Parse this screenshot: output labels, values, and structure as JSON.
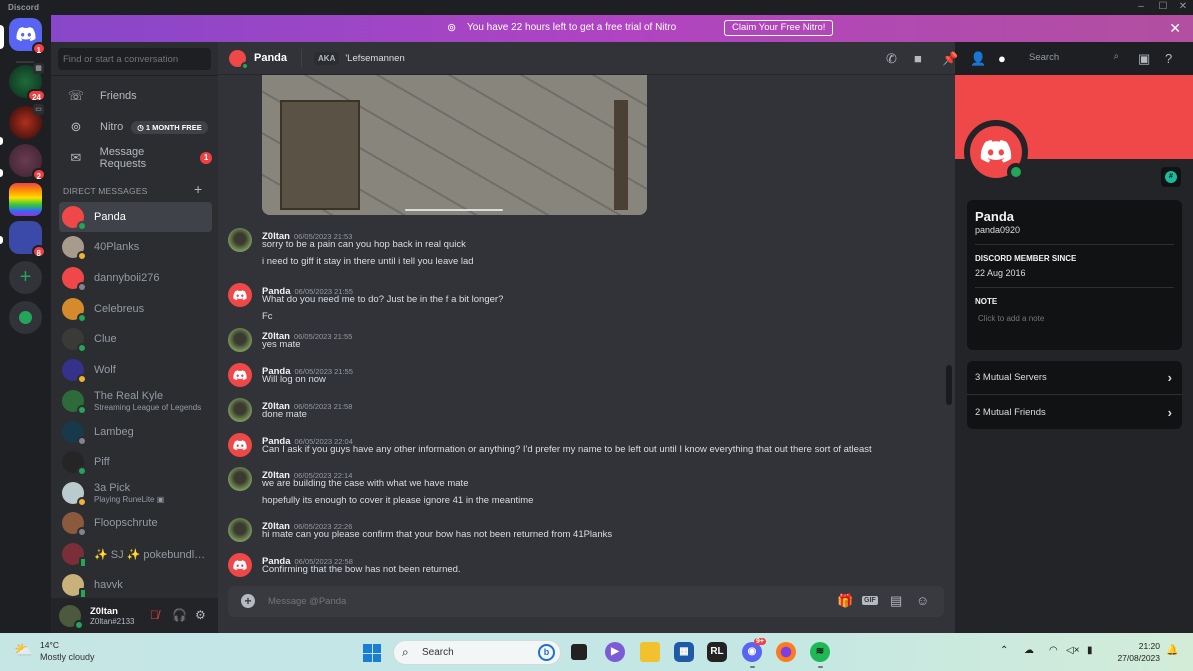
{
  "window": {
    "app_title": "Discord",
    "controls": [
      "minimize",
      "maximize",
      "close"
    ]
  },
  "server_rail": {
    "home": {
      "icon": "discord-logo-icon",
      "badge": "1"
    },
    "servers": [
      {
        "name": "server-pvm",
        "badge": "24",
        "status_icon": "calendar-icon"
      },
      {
        "name": "server-dark",
        "badge": "",
        "status_icon": "monitor-icon"
      },
      {
        "name": "server-p9k",
        "badge": "2",
        "status_icon": ""
      },
      {
        "name": "server-rs",
        "badge": "",
        "status_icon": ""
      },
      {
        "name": "server-folder",
        "badge": "8",
        "status_icon": ""
      }
    ],
    "add_server": "+",
    "explore": "compass-icon"
  },
  "nitro_banner": {
    "text": "You have 22 hours left to get a free trial of Nitro",
    "button": "Claim Your Free Nitro!",
    "close": "✕"
  },
  "dm_sidebar": {
    "search_placeholder": "Find or start a conversation",
    "nav": [
      {
        "label": "Friends",
        "icon": "friends-icon"
      },
      {
        "label": "Nitro",
        "icon": "nitro-icon",
        "tag": "1 MONTH FREE"
      },
      {
        "label": "Message Requests",
        "icon": "envelope-icon",
        "badge": "1"
      }
    ],
    "section_header": "DIRECT MESSAGES",
    "add": "+",
    "dms": [
      {
        "name": "Panda",
        "status": "online",
        "active": true,
        "color": "#f04848"
      },
      {
        "name": "40Planks",
        "status": "idle",
        "color": "#a79b8c"
      },
      {
        "name": "dannyboii276",
        "status": "offline",
        "color": "#f04848"
      },
      {
        "name": "Celebreus",
        "status": "online",
        "color": "#d58a2c"
      },
      {
        "name": "Clue",
        "status": "online",
        "color": "#3a3a36"
      },
      {
        "name": "Wolf",
        "status": "idle",
        "color": "#34328a"
      },
      {
        "name": "The Real Kyle",
        "status": "online",
        "sub": "Streaming League of Legends",
        "color": "#2e6b3a"
      },
      {
        "name": "Lambeg",
        "status": "offline",
        "color": "#17394a"
      },
      {
        "name": "Piff",
        "status": "online",
        "color": "#252525"
      },
      {
        "name": "3a Pick",
        "status": "idle",
        "sub": "Playing RuneLite ▣",
        "color": "#b9cbcc"
      },
      {
        "name": "Floopschrute",
        "status": "offline",
        "color": "#8b5a3c"
      },
      {
        "name": "✨ SJ ✨ pokebundle...",
        "status": "mobile",
        "color": "#7a2f38"
      },
      {
        "name": "havvk",
        "status": "mobile",
        "color": "#c9b17c"
      }
    ],
    "user": {
      "name": "Z0ltan",
      "tag": "Z0ltan#2133",
      "status": "online"
    }
  },
  "chat": {
    "header": {
      "name": "Panda",
      "aka_label": "AKA",
      "aka_name": "'Lefsemannen",
      "search_placeholder": "Search"
    },
    "messages": [
      {
        "author": "Z0ltan",
        "timestamp": "06/05/2023 21:53",
        "avatar": "zoltan",
        "lines": [
          "sorry to be a pain can you hop back in real quick",
          "i need to giff it stay in there until i tell you leave lad"
        ]
      },
      {
        "author": "Panda",
        "timestamp": "06/05/2023 21:55",
        "avatar": "panda",
        "lines": [
          "What do you need me to do? Just be in the f a bit longer?",
          "Fc"
        ]
      },
      {
        "author": "Z0ltan",
        "timestamp": "06/05/2023 21:55",
        "avatar": "zoltan",
        "lines": [
          "yes mate"
        ]
      },
      {
        "author": "Panda",
        "timestamp": "06/05/2023 21:55",
        "avatar": "panda",
        "lines": [
          "Will log on now"
        ]
      },
      {
        "author": "Z0ltan",
        "timestamp": "06/05/2023 21:58",
        "avatar": "zoltan",
        "lines": [
          "done mate"
        ]
      },
      {
        "author": "Panda",
        "timestamp": "06/05/2023 22:04",
        "avatar": "panda",
        "lines": [
          "Can I ask if you guys have any other information or anything? I'd prefer my name to be left out until I know everything that out there sort of atleast"
        ]
      },
      {
        "author": "Z0ltan",
        "timestamp": "06/05/2023 22:14",
        "avatar": "zoltan",
        "lines": [
          "we are building the case with what we have mate",
          "hopefully its enough to cover it please ignore 41 in the meantime"
        ]
      },
      {
        "author": "Z0ltan",
        "timestamp": "06/05/2023 22:26",
        "avatar": "zoltan",
        "lines": [
          "hi mate can you please confirm that your bow has not been returned from 41Planks"
        ]
      },
      {
        "author": "Panda",
        "timestamp": "06/05/2023 22:58",
        "avatar": "panda",
        "lines": [
          "Confirming that the bow has not been returned."
        ]
      }
    ],
    "composer_placeholder": "Message @Panda",
    "composer_gif": "GIF"
  },
  "profile": {
    "display_name": "Panda",
    "username": "panda0920",
    "member_since_label": "DISCORD MEMBER SINCE",
    "member_since": "22 Aug 2016",
    "note_label": "NOTE",
    "note_placeholder": "Click to add a note",
    "mutual_servers": "3 Mutual Servers",
    "mutual_friends": "2 Mutual Friends",
    "banner_color": "#f04848"
  },
  "taskbar": {
    "temperature": "14°C",
    "condition": "Mostly cloudy",
    "search": "Search",
    "discord_badge": "9+",
    "time": "21:20",
    "date": "27/08/2023"
  }
}
